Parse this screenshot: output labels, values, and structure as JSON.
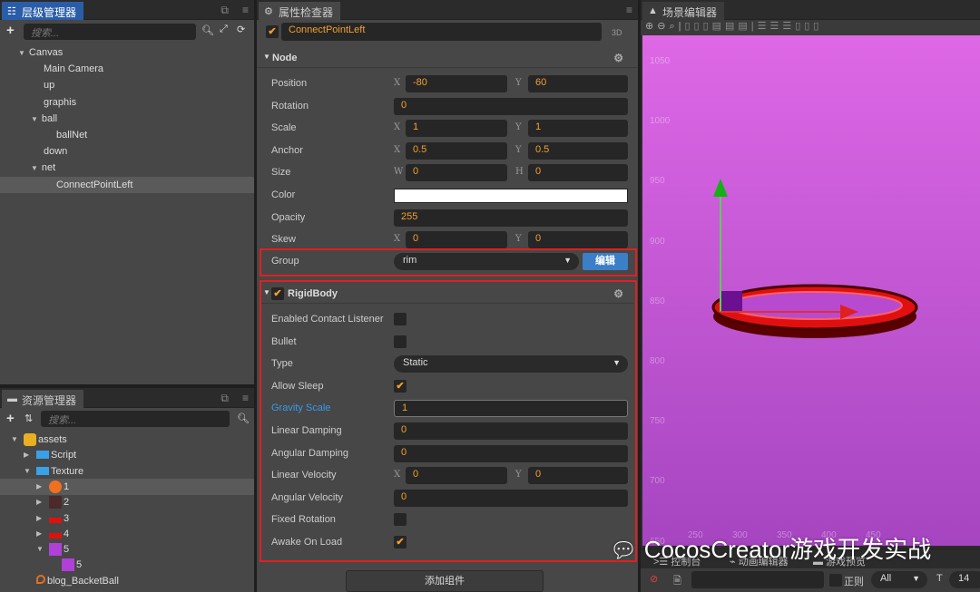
{
  "hierarchy": {
    "title": "层级管理器",
    "search_placeholder": "搜索...",
    "nodes": [
      {
        "label": "Canvas",
        "depth": 0,
        "expanded": true
      },
      {
        "label": "Main Camera",
        "depth": 1
      },
      {
        "label": "up",
        "depth": 1
      },
      {
        "label": "graphis",
        "depth": 1
      },
      {
        "label": "ball",
        "depth": 1,
        "expanded": true
      },
      {
        "label": "ballNet",
        "depth": 2
      },
      {
        "label": "down",
        "depth": 1
      },
      {
        "label": "net",
        "depth": 1,
        "expanded": true
      },
      {
        "label": "ConnectPointLeft",
        "depth": 2,
        "selected": true
      }
    ]
  },
  "assets": {
    "title": "资源管理器",
    "search_placeholder": "搜索...",
    "items": [
      {
        "label": "assets",
        "depth": 0,
        "arrow": "down",
        "icon": "db"
      },
      {
        "label": "Script",
        "depth": 1,
        "arrow": "right",
        "icon": "folder"
      },
      {
        "label": "Texture",
        "depth": 1,
        "arrow": "down",
        "icon": "folder"
      },
      {
        "label": "1",
        "depth": 2,
        "arrow": "right",
        "icon": "ball",
        "selected": true
      },
      {
        "label": "2",
        "depth": 2,
        "arrow": "right",
        "icon": "dark"
      },
      {
        "label": "3",
        "depth": 2,
        "arrow": "right",
        "icon": "red"
      },
      {
        "label": "4",
        "depth": 2,
        "arrow": "right",
        "icon": "red"
      },
      {
        "label": "5",
        "depth": 2,
        "arrow": "down",
        "icon": "purple"
      },
      {
        "label": "5",
        "depth": 3,
        "icon": "purple"
      },
      {
        "label": "blog_BacketBall",
        "depth": 1,
        "icon": "scene"
      }
    ]
  },
  "inspector": {
    "title": "属性检查器",
    "node_name": "ConnectPointLeft",
    "node_enabled": true,
    "mode_3d": "3D",
    "node_section": "Node",
    "node_props": [
      {
        "label": "Position",
        "type": "xy",
        "x": "-80",
        "y": "60"
      },
      {
        "label": "Rotation",
        "type": "num",
        "value": "0"
      },
      {
        "label": "Scale",
        "type": "xy",
        "x": "1",
        "y": "1"
      },
      {
        "label": "Anchor",
        "type": "xy",
        "x": "0.5",
        "y": "0.5"
      },
      {
        "label": "Size",
        "type": "wh",
        "x": "0",
        "y": "0"
      },
      {
        "label": "Color",
        "type": "color",
        "value": "#ffffff"
      },
      {
        "label": "Opacity",
        "type": "num",
        "value": "255"
      },
      {
        "label": "Skew",
        "type": "xy",
        "x": "0",
        "y": "0"
      }
    ],
    "group": {
      "label": "Group",
      "value": "rim",
      "edit_button": "编辑"
    },
    "rigidbody": {
      "title": "RigidBody",
      "enabled": true,
      "props": [
        {
          "label": "Enabled Contact Listener",
          "type": "check",
          "checked": false
        },
        {
          "label": "Bullet",
          "type": "check",
          "checked": false
        },
        {
          "label": "Type",
          "type": "select",
          "value": "Static"
        },
        {
          "label": "Allow Sleep",
          "type": "check",
          "checked": true
        },
        {
          "label": "Gravity Scale",
          "type": "num",
          "value": "1",
          "highlight": true
        },
        {
          "label": "Linear Damping",
          "type": "num",
          "value": "0"
        },
        {
          "label": "Angular Damping",
          "type": "num",
          "value": "0"
        },
        {
          "label": "Linear Velocity",
          "type": "xy",
          "x": "0",
          "y": "0"
        },
        {
          "label": "Angular Velocity",
          "type": "num",
          "value": "0"
        },
        {
          "label": "Fixed Rotation",
          "type": "check",
          "checked": false
        },
        {
          "label": "Awake On Load",
          "type": "check",
          "checked": true
        }
      ]
    },
    "add_component": "添加组件"
  },
  "scene": {
    "title": "场景编辑器",
    "y_ticks": [
      "1050",
      "1000",
      "950",
      "900",
      "850",
      "800",
      "750",
      "700",
      "650"
    ],
    "x_ticks": [
      "250",
      "300",
      "350",
      "400",
      "450"
    ]
  },
  "console": {
    "tabs": [
      "控制台",
      "动画编辑器",
      "游戏预览"
    ],
    "regex_label": "正则",
    "level": "All",
    "font_size": "14"
  },
  "watermark": "CocosCreator游戏开发实战",
  "colors": {
    "accent": "#f0a030",
    "tab_active": "#2a5da8",
    "highlight_box": "#e02020",
    "scene_bg": "#d866e0"
  }
}
